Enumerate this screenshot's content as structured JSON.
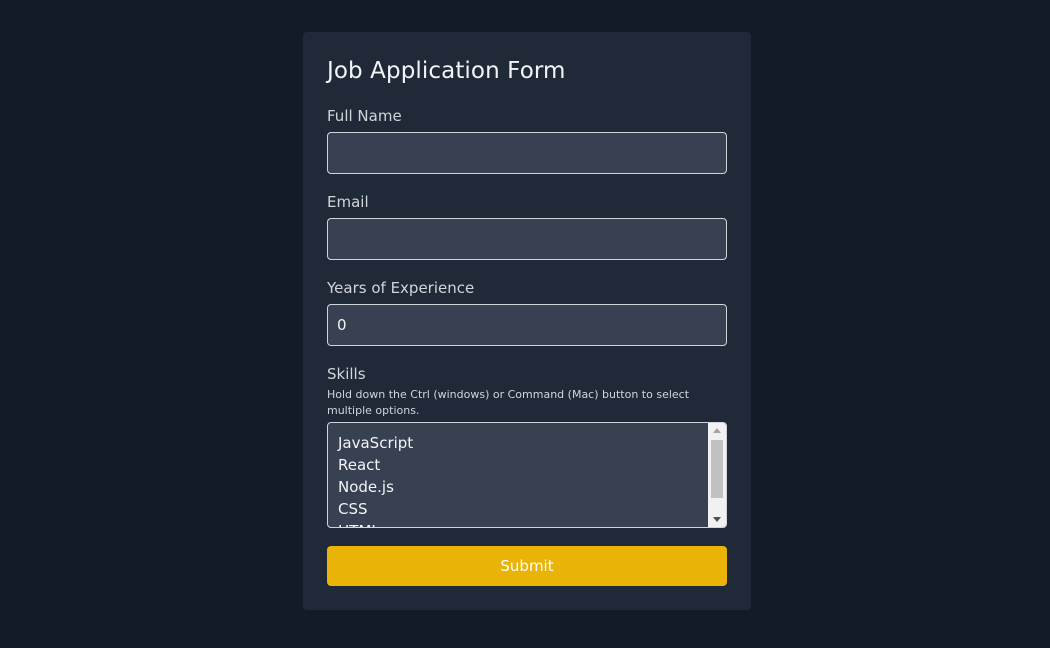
{
  "form": {
    "title": "Job Application Form",
    "full_name": {
      "label": "Full Name",
      "value": ""
    },
    "email": {
      "label": "Email",
      "value": ""
    },
    "experience": {
      "label": "Years of Experience",
      "value": "0"
    },
    "skills": {
      "label": "Skills",
      "hint": "Hold down the Ctrl (windows) or Command (Mac) button to select multiple options.",
      "options": [
        "JavaScript",
        "React",
        "Node.js",
        "CSS",
        "HTML"
      ]
    },
    "submit_label": "Submit"
  },
  "colors": {
    "page_background": "#131a28",
    "card_background": "#1f2937",
    "input_background": "#374151",
    "accent": "#eab308"
  }
}
